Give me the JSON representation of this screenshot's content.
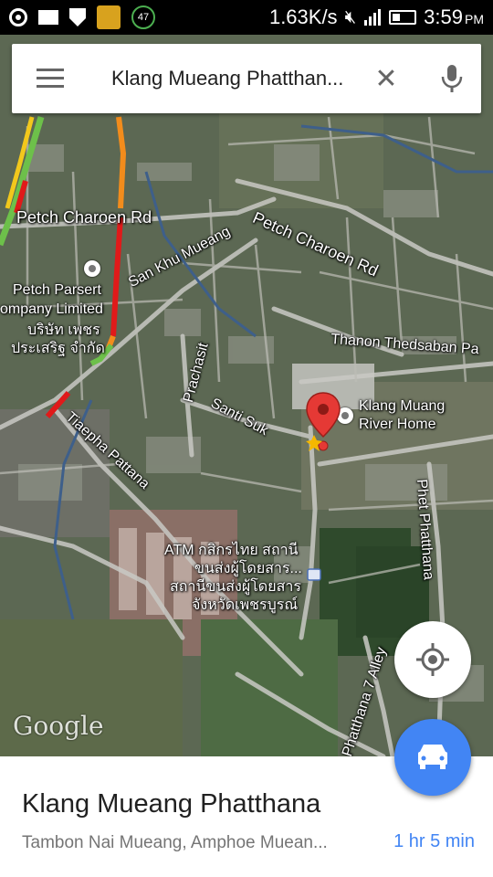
{
  "status_bar": {
    "network_speed": "1.63K/s",
    "time": "3:59",
    "ampm": "PM",
    "badge_count": "47"
  },
  "search": {
    "query": "Klang Mueang Phatthan..."
  },
  "map": {
    "labels": {
      "petch_charoen_left": "Petch Charoen Rd",
      "petch_charoen_right": "Petch Charoen Rd",
      "san_khu_mueang": "San Khu Mueang",
      "petch_parsert_1": "Petch Parsert",
      "petch_parsert_2": "ompany Limited",
      "petch_parsert_3": "บริษัท เพชร",
      "petch_parsert_4": "ประเสริฐ จำกัด",
      "thanon_thedsaban": "Thanon Thedsaban Pa",
      "prachasit": "Prachasit",
      "santi_suk": "Santi Suk",
      "tiaepha_pattana": "Tiaepha Pattana",
      "river_home_1": "Klang Muang",
      "river_home_2": "River Home",
      "phet_phatthana": "Phet Phatthana",
      "atm_1": "ATM กสิกรไทย สถานี",
      "atm_2": "ขนส่งผู้โดยสาร...",
      "atm_3": "สถานีขนส่งผู้โดยสาร",
      "atm_4": "จังหวัดเพชรบูรณ์",
      "alley": "Phatthana 7 Alley",
      "google_logo": "Google"
    },
    "pin_color": "#e53935",
    "traffic_colors": {
      "heavy": "#e01a1a",
      "moderate": "#f28c1c",
      "light": "#6dc04a"
    }
  },
  "place": {
    "name": "Klang Mueang Phatthana",
    "address": "Tambon Nai Mueang, Amphoe Muean...",
    "eta": "1 hr 5 min"
  },
  "icons": [
    "gps-icon",
    "mail-icon",
    "shield-icon",
    "app-icon",
    "mute-icon",
    "signal-icon",
    "battery-icon",
    "menu-icon",
    "close-icon",
    "mic-icon",
    "my-location-icon",
    "car-icon",
    "pin-icon"
  ]
}
